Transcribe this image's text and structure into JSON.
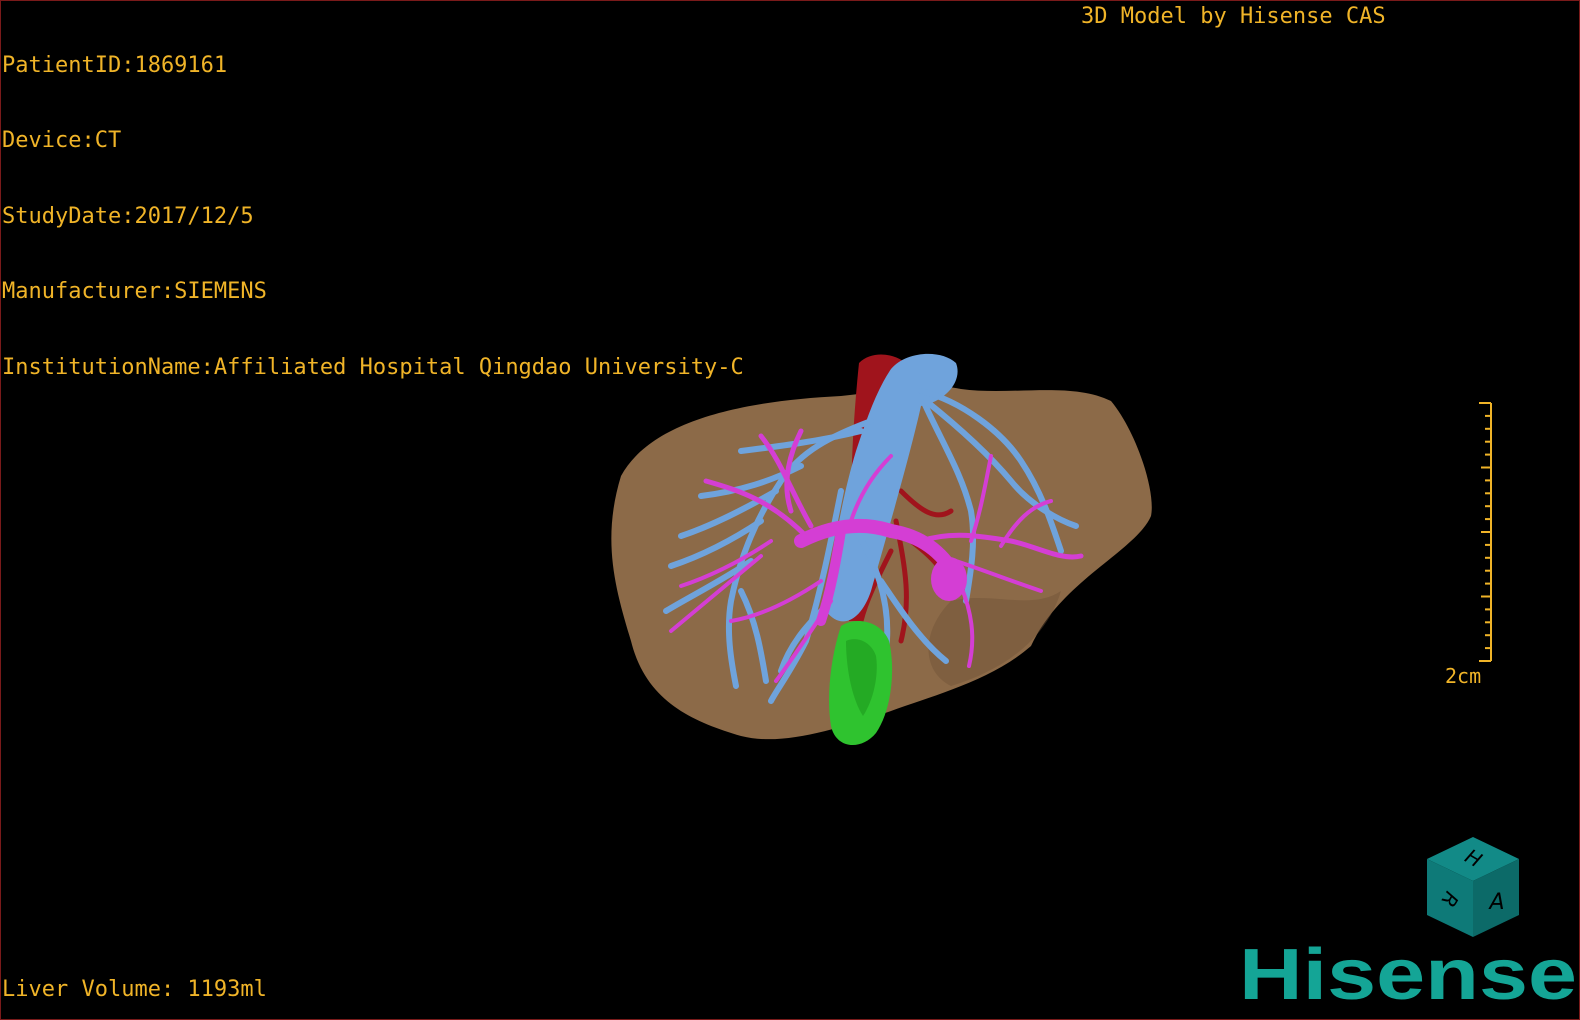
{
  "info": {
    "patient_id": "PatientID:1869161",
    "device": "Device:CT",
    "study_date": "StudyDate:2017/12/5",
    "manufacturer": "Manufacturer:SIEMENS",
    "institution": "InstitutionName:Affiliated Hospital Qingdao University-C"
  },
  "brand_text": "3D Model by Hisense CAS",
  "liver_volume": "Liver Volume: 1193ml",
  "scale": {
    "label": "2cm",
    "length_cm": 2
  },
  "orientation_cube": {
    "faces": [
      "H",
      "R",
      "A"
    ],
    "color": "#0e7a78"
  },
  "logo": {
    "text": "Hisense",
    "color": "#14a596"
  },
  "colors": {
    "text": "#f0b428",
    "liver": "#8c6a48",
    "hepatic_vein": "#6fa3dc",
    "portal_vein": "#d43ed4",
    "artery": "#a0141c",
    "gallbladder": "#2fc32f",
    "border": "#7a1a1a"
  }
}
